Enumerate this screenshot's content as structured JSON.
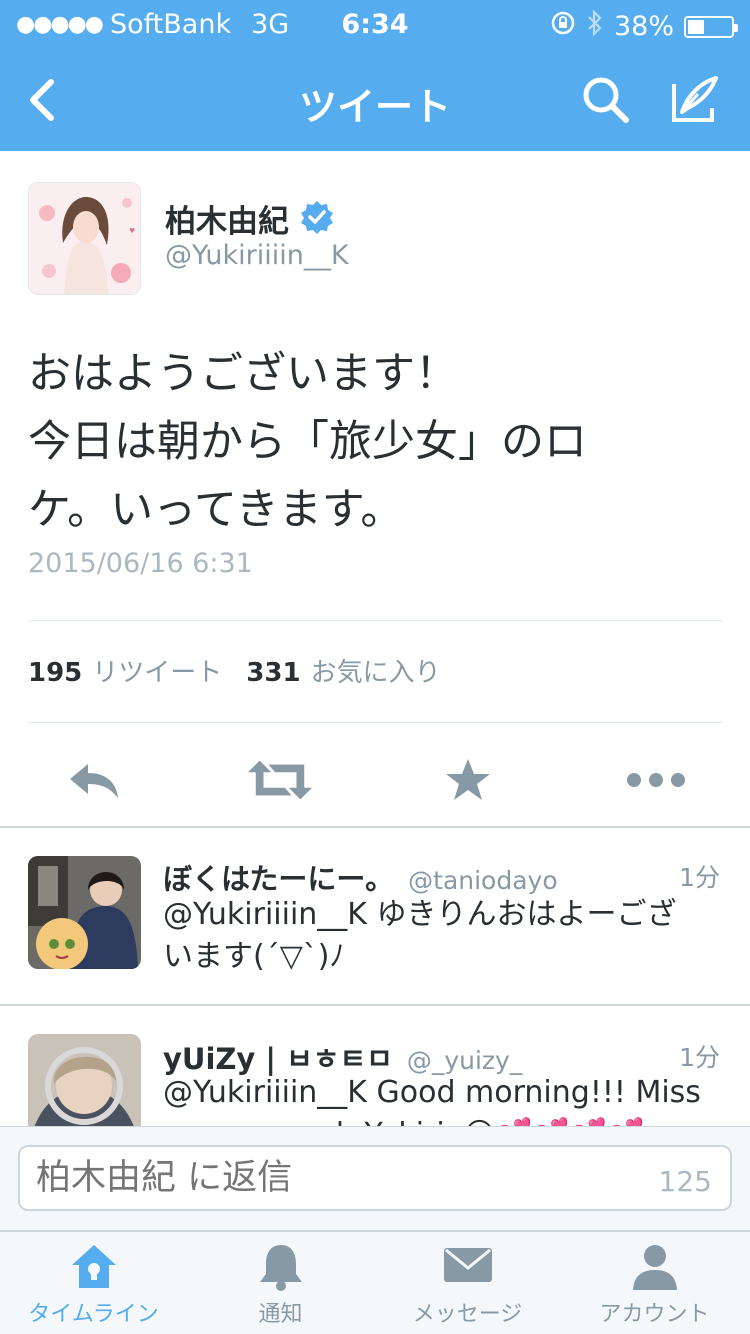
{
  "status_bar": {
    "signal": "●●●●●",
    "carrier": "SoftBank",
    "network": "3G",
    "time": "6:34",
    "battery_percent": "38%",
    "battery_level": 0.38
  },
  "nav": {
    "title": "ツイート",
    "back_icon": "chevron-left-icon",
    "search_icon": "search-icon",
    "compose_icon": "compose-icon"
  },
  "tweet": {
    "author_name": "柏木由紀",
    "author_handle": "@Yukiriiiin__K",
    "verified": true,
    "text_lines": [
      "おはようございます！",
      "今日は朝から「旅少女」のロ",
      "ケ。いってきます。"
    ],
    "date": "2015/06/16 6:31",
    "retweet_count": "195",
    "retweet_label": "リツイート",
    "favorite_count": "331",
    "favorite_label": "お気に入り"
  },
  "actions": [
    "reply-icon",
    "retweet-icon",
    "star-icon",
    "more-icon"
  ],
  "replies": [
    {
      "name": "ぼくはたーにー。",
      "handle": "@taniodayo",
      "ago": "1分",
      "lines": [
        "@Yukiriiiin__K ゆきりんおはよーござ",
        "います(´▽`)ﾉ"
      ]
    },
    {
      "name": "yUiZy | ㅂㅎㅌㅁ",
      "handle": "@_yuizy_",
      "ago": "1分",
      "lines": [
        "@Yukiriiiin__K Good morning!!! Miss",
        "you so much Yukirin😊💕💕💕💕"
      ]
    }
  ],
  "composer": {
    "placeholder": "柏木由紀 に返信",
    "char_count": "125"
  },
  "tabs": [
    {
      "label": "タイムライン",
      "icon": "home-icon",
      "active": true
    },
    {
      "label": "通知",
      "icon": "bell-icon",
      "active": false
    },
    {
      "label": "メッセージ",
      "icon": "envelope-icon",
      "active": false
    },
    {
      "label": "アカウント",
      "icon": "person-icon",
      "active": false
    }
  ],
  "colors": {
    "brand": "#55acee",
    "text": "#292f33",
    "muted": "#8899a6",
    "tab_inactive": "#8899a6"
  }
}
